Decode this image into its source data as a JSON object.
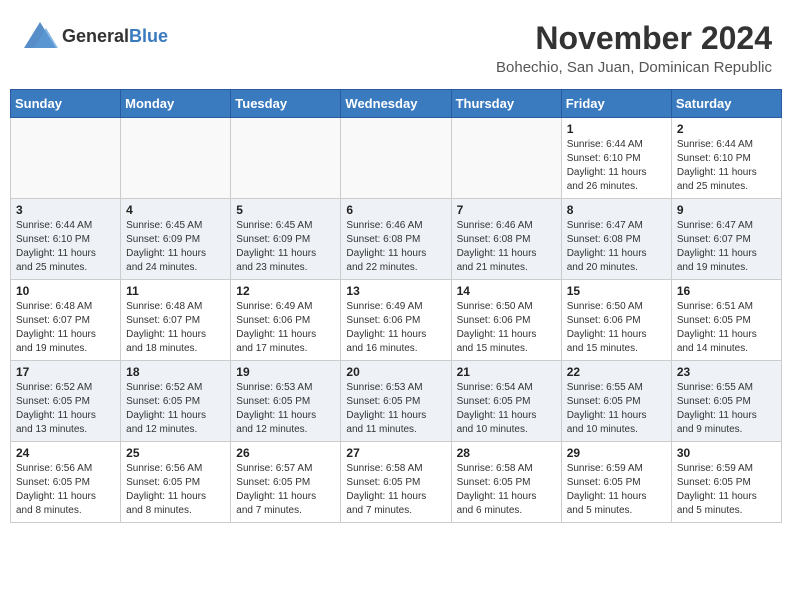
{
  "header": {
    "logo_general": "General",
    "logo_blue": "Blue",
    "month_title": "November 2024",
    "location": "Bohechio, San Juan, Dominican Republic"
  },
  "weekdays": [
    "Sunday",
    "Monday",
    "Tuesday",
    "Wednesday",
    "Thursday",
    "Friday",
    "Saturday"
  ],
  "weeks": [
    {
      "days": [
        {
          "num": "",
          "info": ""
        },
        {
          "num": "",
          "info": ""
        },
        {
          "num": "",
          "info": ""
        },
        {
          "num": "",
          "info": ""
        },
        {
          "num": "",
          "info": ""
        },
        {
          "num": "1",
          "info": "Sunrise: 6:44 AM\nSunset: 6:10 PM\nDaylight: 11 hours\nand 26 minutes."
        },
        {
          "num": "2",
          "info": "Sunrise: 6:44 AM\nSunset: 6:10 PM\nDaylight: 11 hours\nand 25 minutes."
        }
      ]
    },
    {
      "days": [
        {
          "num": "3",
          "info": "Sunrise: 6:44 AM\nSunset: 6:10 PM\nDaylight: 11 hours\nand 25 minutes."
        },
        {
          "num": "4",
          "info": "Sunrise: 6:45 AM\nSunset: 6:09 PM\nDaylight: 11 hours\nand 24 minutes."
        },
        {
          "num": "5",
          "info": "Sunrise: 6:45 AM\nSunset: 6:09 PM\nDaylight: 11 hours\nand 23 minutes."
        },
        {
          "num": "6",
          "info": "Sunrise: 6:46 AM\nSunset: 6:08 PM\nDaylight: 11 hours\nand 22 minutes."
        },
        {
          "num": "7",
          "info": "Sunrise: 6:46 AM\nSunset: 6:08 PM\nDaylight: 11 hours\nand 21 minutes."
        },
        {
          "num": "8",
          "info": "Sunrise: 6:47 AM\nSunset: 6:08 PM\nDaylight: 11 hours\nand 20 minutes."
        },
        {
          "num": "9",
          "info": "Sunrise: 6:47 AM\nSunset: 6:07 PM\nDaylight: 11 hours\nand 19 minutes."
        }
      ]
    },
    {
      "days": [
        {
          "num": "10",
          "info": "Sunrise: 6:48 AM\nSunset: 6:07 PM\nDaylight: 11 hours\nand 19 minutes."
        },
        {
          "num": "11",
          "info": "Sunrise: 6:48 AM\nSunset: 6:07 PM\nDaylight: 11 hours\nand 18 minutes."
        },
        {
          "num": "12",
          "info": "Sunrise: 6:49 AM\nSunset: 6:06 PM\nDaylight: 11 hours\nand 17 minutes."
        },
        {
          "num": "13",
          "info": "Sunrise: 6:49 AM\nSunset: 6:06 PM\nDaylight: 11 hours\nand 16 minutes."
        },
        {
          "num": "14",
          "info": "Sunrise: 6:50 AM\nSunset: 6:06 PM\nDaylight: 11 hours\nand 15 minutes."
        },
        {
          "num": "15",
          "info": "Sunrise: 6:50 AM\nSunset: 6:06 PM\nDaylight: 11 hours\nand 15 minutes."
        },
        {
          "num": "16",
          "info": "Sunrise: 6:51 AM\nSunset: 6:05 PM\nDaylight: 11 hours\nand 14 minutes."
        }
      ]
    },
    {
      "days": [
        {
          "num": "17",
          "info": "Sunrise: 6:52 AM\nSunset: 6:05 PM\nDaylight: 11 hours\nand 13 minutes."
        },
        {
          "num": "18",
          "info": "Sunrise: 6:52 AM\nSunset: 6:05 PM\nDaylight: 11 hours\nand 12 minutes."
        },
        {
          "num": "19",
          "info": "Sunrise: 6:53 AM\nSunset: 6:05 PM\nDaylight: 11 hours\nand 12 minutes."
        },
        {
          "num": "20",
          "info": "Sunrise: 6:53 AM\nSunset: 6:05 PM\nDaylight: 11 hours\nand 11 minutes."
        },
        {
          "num": "21",
          "info": "Sunrise: 6:54 AM\nSunset: 6:05 PM\nDaylight: 11 hours\nand 10 minutes."
        },
        {
          "num": "22",
          "info": "Sunrise: 6:55 AM\nSunset: 6:05 PM\nDaylight: 11 hours\nand 10 minutes."
        },
        {
          "num": "23",
          "info": "Sunrise: 6:55 AM\nSunset: 6:05 PM\nDaylight: 11 hours\nand 9 minutes."
        }
      ]
    },
    {
      "days": [
        {
          "num": "24",
          "info": "Sunrise: 6:56 AM\nSunset: 6:05 PM\nDaylight: 11 hours\nand 8 minutes."
        },
        {
          "num": "25",
          "info": "Sunrise: 6:56 AM\nSunset: 6:05 PM\nDaylight: 11 hours\nand 8 minutes."
        },
        {
          "num": "26",
          "info": "Sunrise: 6:57 AM\nSunset: 6:05 PM\nDaylight: 11 hours\nand 7 minutes."
        },
        {
          "num": "27",
          "info": "Sunrise: 6:58 AM\nSunset: 6:05 PM\nDaylight: 11 hours\nand 7 minutes."
        },
        {
          "num": "28",
          "info": "Sunrise: 6:58 AM\nSunset: 6:05 PM\nDaylight: 11 hours\nand 6 minutes."
        },
        {
          "num": "29",
          "info": "Sunrise: 6:59 AM\nSunset: 6:05 PM\nDaylight: 11 hours\nand 5 minutes."
        },
        {
          "num": "30",
          "info": "Sunrise: 6:59 AM\nSunset: 6:05 PM\nDaylight: 11 hours\nand 5 minutes."
        }
      ]
    }
  ]
}
